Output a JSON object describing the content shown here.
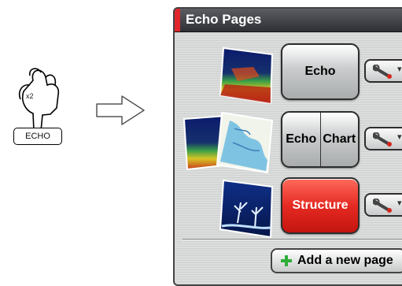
{
  "instruction": {
    "press_count": "x2",
    "key_label": "ECHO"
  },
  "panel": {
    "title": "Echo Pages",
    "rows": [
      {
        "page_label": "Echo",
        "thumbnails": [
          "echo-thumbnail"
        ]
      },
      {
        "page_label_left": "Echo",
        "page_label_right": "Chart",
        "thumbnails": [
          "echo-thumbnail",
          "chart-thumbnail"
        ]
      },
      {
        "page_label": "Structure",
        "selected": true,
        "thumbnails": [
          "structure-thumbnail"
        ]
      }
    ],
    "add_button_label": "Add a new page"
  },
  "colors": {
    "title_bar": "#3a3c41",
    "title_accent": "#e0262a",
    "selected_button": "#e52a22",
    "panel_background": "#d6d8d8"
  }
}
